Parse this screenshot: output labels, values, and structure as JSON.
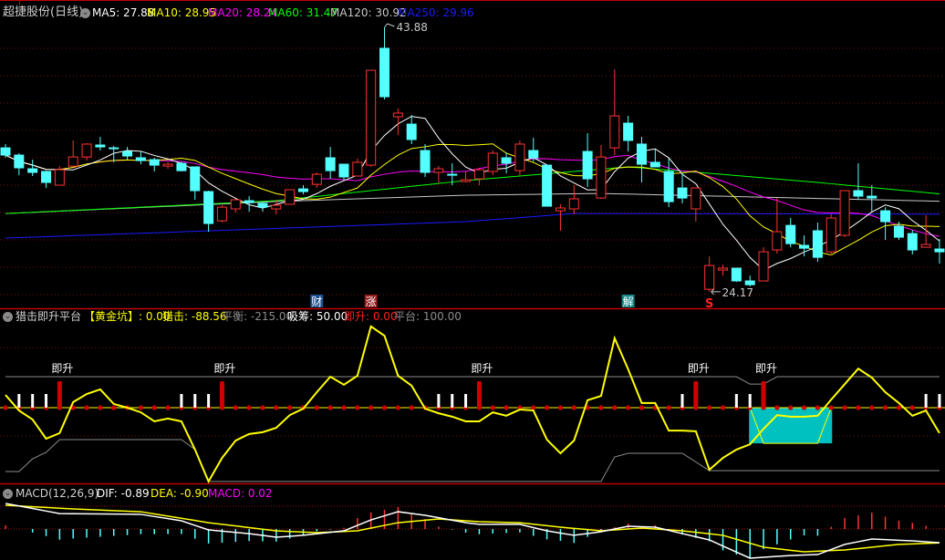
{
  "header": {
    "title": "超捷股份(日线)",
    "ma": [
      {
        "label": "MA5: 27.88",
        "color": "#ffffff"
      },
      {
        "label": "MA10: 28.95",
        "color": "#ffff00"
      },
      {
        "label": "MA20: 28.24",
        "color": "#ff00ff"
      },
      {
        "label": "MA60: 31.47",
        "color": "#00ff00"
      },
      {
        "label": "MA120: 30.92",
        "color": "#c8c8c8"
      },
      {
        "label": "MA250: 29.96",
        "color": "#1a1aff"
      }
    ]
  },
  "indicator": {
    "title": "猎击即升平台",
    "items": [
      {
        "label": "【黄金坑】: 0.00",
        "color": "#ffff00"
      },
      {
        "label": "猎击: -88.56",
        "color": "#ffff00"
      },
      {
        "label": "平衡: -215.00",
        "color": "#8c8c8c"
      },
      {
        "label": "吸筹: 50.00",
        "color": "#ffffff"
      },
      {
        "label": "即升: 0.00",
        "color": "#ff2020"
      },
      {
        "label": "平台: 100.00",
        "color": "#8c8c8c"
      }
    ],
    "bar_label": "即升"
  },
  "macd_header": {
    "title": "MACD(12,26,9)",
    "items": [
      {
        "label": "DIF: -0.89",
        "color": "#ffffff"
      },
      {
        "label": "DEA: -0.90",
        "color": "#ffff00"
      },
      {
        "label": "MACD: 0.02",
        "color": "#ff00ff"
      }
    ]
  },
  "chart_data": [
    {
      "type": "candlestick",
      "title": "超捷股份(日线)",
      "ylim": [
        24.17,
        43.88
      ],
      "high_label": "43.88",
      "low_label": "24.17",
      "high_index": 28,
      "low_index": 52,
      "ohlc": [
        [
          34.9,
          35.18,
          34.16,
          34.36
        ],
        [
          34.36,
          34.5,
          32.86,
          33.41
        ],
        [
          33.34,
          34.02,
          32.8,
          33.07
        ],
        [
          33.14,
          33.2,
          31.91,
          32.32
        ],
        [
          32.12,
          33.54,
          32.12,
          33.27
        ],
        [
          33.54,
          35.45,
          33.48,
          34.22
        ],
        [
          34.22,
          35.24,
          33.95,
          35.18
        ],
        [
          35.11,
          35.72,
          34.7,
          34.97
        ],
        [
          34.9,
          35.04,
          33.82,
          34.84
        ],
        [
          34.63,
          34.97,
          34.02,
          34.29
        ],
        [
          34.16,
          34.63,
          33.68,
          33.95
        ],
        [
          34.02,
          34.16,
          33.14,
          33.61
        ],
        [
          33.54,
          33.82,
          33.34,
          33.68
        ],
        [
          33.75,
          33.88,
          33.14,
          33.2
        ],
        [
          33.48,
          33.48,
          31.03,
          31.71
        ],
        [
          31.64,
          31.71,
          28.65,
          29.26
        ],
        [
          29.46,
          30.62,
          29.33,
          30.48
        ],
        [
          30.35,
          31.1,
          30.08,
          31.03
        ],
        [
          30.96,
          31.3,
          30.14,
          30.82
        ],
        [
          30.76,
          30.89,
          30.14,
          30.48
        ],
        [
          30.35,
          31.03,
          29.94,
          30.62
        ],
        [
          30.69,
          31.78,
          30.69,
          31.78
        ],
        [
          31.84,
          32.12,
          31.44,
          31.64
        ],
        [
          32.18,
          33.07,
          31.91,
          32.93
        ],
        [
          34.16,
          34.97,
          32.59,
          33.2
        ],
        [
          33.68,
          33.68,
          32.52,
          32.73
        ],
        [
          32.8,
          34.09,
          32.8,
          33.82
        ],
        [
          33.61,
          40.68,
          33.48,
          40.68
        ],
        [
          42.32,
          43.88,
          38.51,
          38.71
        ],
        [
          37.22,
          37.83,
          35.86,
          37.49
        ],
        [
          36.67,
          37.35,
          35.18,
          35.52
        ],
        [
          34.7,
          35.18,
          32.73,
          33.07
        ],
        [
          33.07,
          33.54,
          32.32,
          33.34
        ],
        [
          32.93,
          33.75,
          32.12,
          32.86
        ],
        [
          32.39,
          33.14,
          32.32,
          32.52
        ],
        [
          32.59,
          33.41,
          32.12,
          33.27
        ],
        [
          33.14,
          34.7,
          32.86,
          34.5
        ],
        [
          34.16,
          34.56,
          33.0,
          33.75
        ],
        [
          33.2,
          35.45,
          32.86,
          35.18
        ],
        [
          34.7,
          35.65,
          33.88,
          34.16
        ],
        [
          33.61,
          33.61,
          30.55,
          30.55
        ],
        [
          30.21,
          30.69,
          28.72,
          30.42
        ],
        [
          30.35,
          32.12,
          29.94,
          31.1
        ],
        [
          34.63,
          35.99,
          31.98,
          32.59
        ],
        [
          31.16,
          35.11,
          31.1,
          34.22
        ],
        [
          34.9,
          40.75,
          34.36,
          37.28
        ],
        [
          36.74,
          37.28,
          34.63,
          35.45
        ],
        [
          35.18,
          35.72,
          32.32,
          33.68
        ],
        [
          33.82,
          34.77,
          33.48,
          33.48
        ],
        [
          33.14,
          34.09,
          30.48,
          30.89
        ],
        [
          31.91,
          33.0,
          30.76,
          31.16
        ],
        [
          30.35,
          31.91,
          29.4,
          31.91
        ],
        [
          24.36,
          26.81,
          24.17,
          26.13
        ],
        [
          25.79,
          26.2,
          25.38,
          25.93
        ],
        [
          25.93,
          25.93,
          24.91,
          24.98
        ],
        [
          24.98,
          25.38,
          24.57,
          24.7
        ],
        [
          24.98,
          27.49,
          24.98,
          27.15
        ],
        [
          27.29,
          31.16,
          27.02,
          28.65
        ],
        [
          29.12,
          29.67,
          27.49,
          27.76
        ],
        [
          27.63,
          28.38,
          26.81,
          27.42
        ],
        [
          28.72,
          29.33,
          26.4,
          26.74
        ],
        [
          27.15,
          29.94,
          26.88,
          29.67
        ],
        [
          28.38,
          31.71,
          28.24,
          31.71
        ],
        [
          31.71,
          33.75,
          31.03,
          31.3
        ],
        [
          31.3,
          32.12,
          30.14,
          31.16
        ],
        [
          30.21,
          30.48,
          28.04,
          29.4
        ],
        [
          29.06,
          29.4,
          28.04,
          28.24
        ],
        [
          28.51,
          28.78,
          26.95,
          27.29
        ],
        [
          27.49,
          29.87,
          27.49,
          27.7
        ],
        [
          27.36,
          28.1,
          26.27,
          27.15
        ]
      ],
      "ma_periods": [
        5,
        10,
        20
      ],
      "long_ma": {
        "MA60": [
          [
            0,
            30.0
          ],
          [
            20,
            30.96
          ],
          [
            34,
            32.46
          ],
          [
            46,
            33.48
          ],
          [
            52,
            33.0
          ],
          [
            60,
            32.32
          ],
          [
            69,
            31.47
          ]
        ],
        "MA120": [
          [
            0,
            30.0
          ],
          [
            20,
            30.9
          ],
          [
            34,
            31.37
          ],
          [
            44,
            31.5
          ],
          [
            69,
            30.92
          ]
        ],
        "MA250": [
          [
            0,
            28.17
          ],
          [
            34,
            29.4
          ],
          [
            42,
            30.0
          ],
          [
            69,
            29.96
          ]
        ]
      },
      "colors": {
        "up": "#ff3232",
        "down": "#54ffff",
        "MA5": "#ffffff",
        "MA10": "#ffff00",
        "MA20": "#ff00ff",
        "MA60": "#00ff00",
        "MA120": "#c8c8c8",
        "MA250": "#1a1aff"
      },
      "markers": [
        {
          "index": 23,
          "text": "财",
          "bg": "#1b4f8f",
          "color": "#ffffff"
        },
        {
          "index": 27,
          "text": "涨",
          "bg": "#8f1b1b",
          "color": "#ffffff"
        },
        {
          "index": 46,
          "text": "解",
          "bg": "#138585",
          "color": "#ffffff"
        },
        {
          "index": 52,
          "text": "S",
          "bg": "",
          "color": "#ff2020"
        }
      ],
      "grid": true
    },
    {
      "type": "line",
      "title": "猎击即升平台",
      "lieji": [
        41,
        -9,
        -38,
        -100,
        -82,
        18,
        44,
        59,
        12,
        0,
        -15,
        -44,
        -35,
        -44,
        -135,
        -238,
        -162,
        -106,
        -85,
        -79,
        -65,
        -24,
        -3,
        50,
        100,
        74,
        103,
        262,
        232,
        103,
        71,
        -3,
        -18,
        -29,
        -44,
        -44,
        -15,
        -26,
        -6,
        -9,
        -103,
        -147,
        -106,
        24,
        38,
        224,
        124,
        15,
        15,
        -74,
        -74,
        -76,
        -200,
        -162,
        -135,
        -118,
        -68,
        -24,
        -29,
        -29,
        -26,
        26,
        76,
        126,
        97,
        50,
        15,
        -26,
        -9,
        -82
      ],
      "pingheng": [
        -206,
        -206,
        -165,
        -144,
        -103,
        -103,
        -103,
        -103,
        -103,
        -103,
        -103,
        -103,
        -103,
        -103,
        -135,
        -238,
        -238,
        -238,
        -238,
        -238,
        -238,
        -238,
        -238,
        -238,
        -238,
        -238,
        -238,
        -238,
        -238,
        -238,
        -238,
        -238,
        -238,
        -238,
        -238,
        -238,
        -238,
        -238,
        -238,
        -238,
        -238,
        -238,
        -238,
        -238,
        -238,
        -159,
        -147,
        -147,
        -147,
        -147,
        -147,
        -175,
        -203,
        -203,
        -203,
        -203,
        -203,
        -203,
        -203,
        -203,
        -203,
        -203,
        -203,
        -203,
        -203,
        -203,
        -203,
        -203,
        -203,
        -203
      ],
      "pingtai": [
        100,
        100,
        100,
        100,
        100,
        100,
        100,
        100,
        100,
        100,
        100,
        100,
        100,
        100,
        100,
        100,
        100,
        100,
        100,
        100,
        100,
        100,
        100,
        100,
        100,
        100,
        100,
        100,
        100,
        100,
        100,
        100,
        100,
        100,
        100,
        100,
        100,
        100,
        100,
        100,
        100,
        100,
        100,
        100,
        100,
        100,
        100,
        100,
        100,
        100,
        100,
        100,
        100,
        100,
        100,
        76,
        76,
        100,
        100,
        100,
        100,
        100,
        100,
        100,
        100,
        100,
        100,
        100,
        100,
        100
      ],
      "xichou_indices": [
        1,
        2,
        3,
        13,
        14,
        15,
        32,
        33,
        34,
        50,
        54,
        55,
        68,
        69
      ],
      "xichou_value": 50,
      "jisheng_indices": [
        4,
        16,
        35,
        51,
        56
      ],
      "jisheng_value": 85,
      "huangjinkeng": {
        "start": 55,
        "end": 61,
        "value": -115
      }
    },
    {
      "type": "macd",
      "title": "MACD(12,26,9)",
      "dif": [
        [
          0,
          1.66
        ],
        [
          4,
          1.0
        ],
        [
          10,
          0.95
        ],
        [
          13,
          0.53
        ],
        [
          15,
          -0.06
        ],
        [
          18,
          -0.3
        ],
        [
          20,
          -0.53
        ],
        [
          22,
          -0.41
        ],
        [
          25,
          -0.12
        ],
        [
          27,
          0.59
        ],
        [
          29,
          1.12
        ],
        [
          31,
          0.89
        ],
        [
          34,
          0.41
        ],
        [
          35,
          0.3
        ],
        [
          38,
          0.3
        ],
        [
          40,
          -0.12
        ],
        [
          42,
          -0.41
        ],
        [
          44,
          -0.18
        ],
        [
          46,
          0.18
        ],
        [
          48,
          0.12
        ],
        [
          50,
          -0.3
        ],
        [
          52,
          -0.71
        ],
        [
          55,
          -1.89
        ],
        [
          58,
          -1.72
        ],
        [
          60,
          -1.66
        ],
        [
          62,
          -1.0
        ],
        [
          64,
          -0.65
        ],
        [
          67,
          -0.77
        ],
        [
          69,
          -0.89
        ]
      ],
      "dea": [
        [
          0,
          1.54
        ],
        [
          5,
          1.3
        ],
        [
          10,
          1.12
        ],
        [
          15,
          0.41
        ],
        [
          20,
          -0.12
        ],
        [
          23,
          -0.24
        ],
        [
          26,
          -0.12
        ],
        [
          29,
          0.41
        ],
        [
          32,
          0.65
        ],
        [
          35,
          0.47
        ],
        [
          38,
          0.41
        ],
        [
          41,
          0.12
        ],
        [
          44,
          -0.12
        ],
        [
          47,
          0.06
        ],
        [
          50,
          -0.12
        ],
        [
          53,
          -0.41
        ],
        [
          56,
          -1.18
        ],
        [
          59,
          -1.48
        ],
        [
          62,
          -1.36
        ],
        [
          66,
          -1.0
        ],
        [
          69,
          -0.9
        ]
      ]
    }
  ]
}
